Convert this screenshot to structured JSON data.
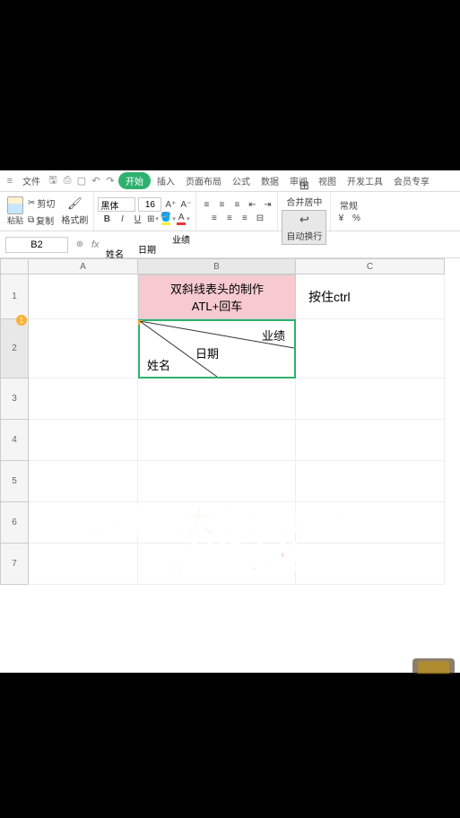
{
  "menu": {
    "file": "文件",
    "start": "开始",
    "insert": "插入",
    "layout": "页面布局",
    "formula": "公式",
    "data": "数据",
    "review": "审阅",
    "view": "视图",
    "dev": "开发工具",
    "member": "会员专享"
  },
  "ribbon": {
    "paste": "粘贴",
    "cut": "剪切",
    "copy": "复制",
    "format_painter": "格式刷",
    "font_name": "黑体",
    "font_size": "16",
    "merge": "合并居中",
    "wrap": "自动换行",
    "format_general": "常规",
    "currency": "¥",
    "percent": "%"
  },
  "namebox": "B2",
  "formula": {
    "l1": "业绩",
    "l2": "日期",
    "l3": "姓名"
  },
  "columns": {
    "a": "A",
    "b": "B",
    "c": "C"
  },
  "rows": [
    "1",
    "2",
    "3",
    "4",
    "5",
    "6",
    "7"
  ],
  "cells": {
    "b1_line1": "双斜线表头的制作",
    "b1_line2": "ATL+回车",
    "c1": "按住ctrl",
    "b2_tr": "业绩",
    "b2_mid": "日期",
    "b2_bl": "姓名"
  },
  "overlay": {
    "line1": "这期教大家怎么制作",
    "line2": "双斜线表格"
  },
  "comment_num": "1"
}
